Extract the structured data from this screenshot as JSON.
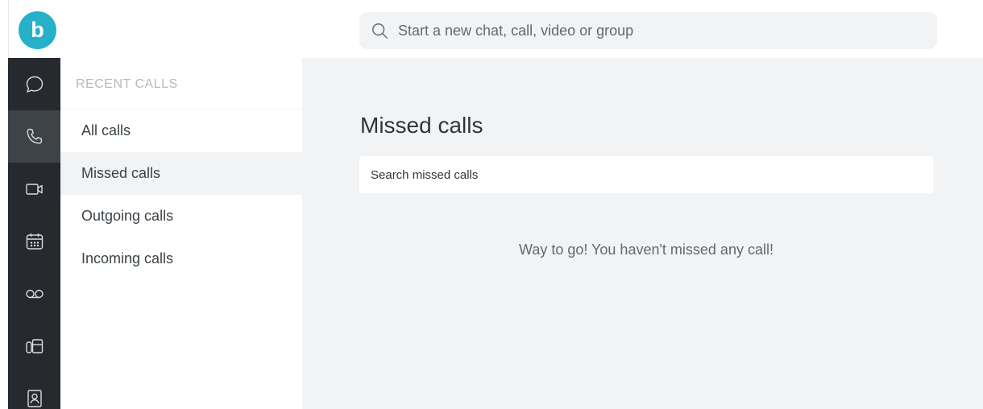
{
  "brand": {
    "logo_letter": "b",
    "accent": "#26b1c9"
  },
  "top_search": {
    "placeholder": "Start a new chat, call, video or group",
    "icon": "search-icon"
  },
  "rail": {
    "items": [
      {
        "name": "chat",
        "icon": "chat-bubble-icon",
        "active": false
      },
      {
        "name": "calls",
        "icon": "phone-icon",
        "active": true
      },
      {
        "name": "video",
        "icon": "video-camera-icon",
        "active": false
      },
      {
        "name": "calendar",
        "icon": "calendar-icon",
        "active": false
      },
      {
        "name": "voicemail",
        "icon": "voicemail-icon",
        "active": false
      },
      {
        "name": "devices",
        "icon": "desk-phone-icon",
        "active": false
      },
      {
        "name": "contacts",
        "icon": "contact-book-icon",
        "active": false
      }
    ]
  },
  "subnav": {
    "header": "RECENT CALLS",
    "items": [
      {
        "label": "All calls",
        "active": false
      },
      {
        "label": "Missed calls",
        "active": true
      },
      {
        "label": "Outgoing calls",
        "active": false
      },
      {
        "label": "Incoming calls",
        "active": false
      }
    ]
  },
  "main": {
    "title": "Missed calls",
    "search_placeholder": "Search missed calls",
    "empty_message": "Way to go! You haven't missed any call!"
  }
}
